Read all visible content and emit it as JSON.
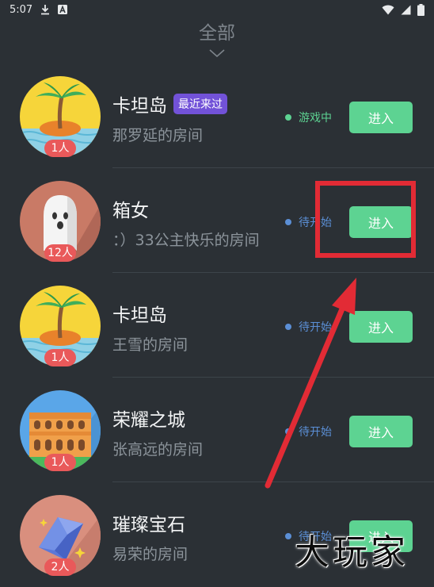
{
  "statusbar": {
    "time": "5:07"
  },
  "filter": {
    "label": "全部"
  },
  "colors": {
    "accent": "#5dd392",
    "badge": "#7252d8",
    "count": "#e9595a",
    "playing": "#5dd392",
    "waiting": "#5b8fd6",
    "highlight": "#e22b35"
  },
  "rooms": [
    {
      "icon": "palm-island-icon",
      "title": "卡坦岛",
      "badge": "最近来过",
      "subtitle": "那罗延的房间",
      "count": "1人",
      "status": "游戏中",
      "enter": "进入"
    },
    {
      "icon": "ghost-icon",
      "title": "箱女",
      "subtitle": "：）33公主快乐的房间",
      "count": "12人",
      "status": "待开始",
      "enter": "进入"
    },
    {
      "icon": "palm-island-icon",
      "title": "卡坦岛",
      "subtitle": "王雪的房间",
      "count": "1人",
      "status": "待开始",
      "enter": "进入"
    },
    {
      "icon": "castle-icon",
      "title": "荣耀之城",
      "subtitle": "张高远的房间",
      "count": "1人",
      "status": "待开始",
      "enter": "进入"
    },
    {
      "icon": "gem-icon",
      "title": "璀璨宝石",
      "subtitle": "易荣的房间",
      "count": "2人",
      "status": "待开始",
      "enter": "进入"
    }
  ],
  "watermark": "大玩家"
}
